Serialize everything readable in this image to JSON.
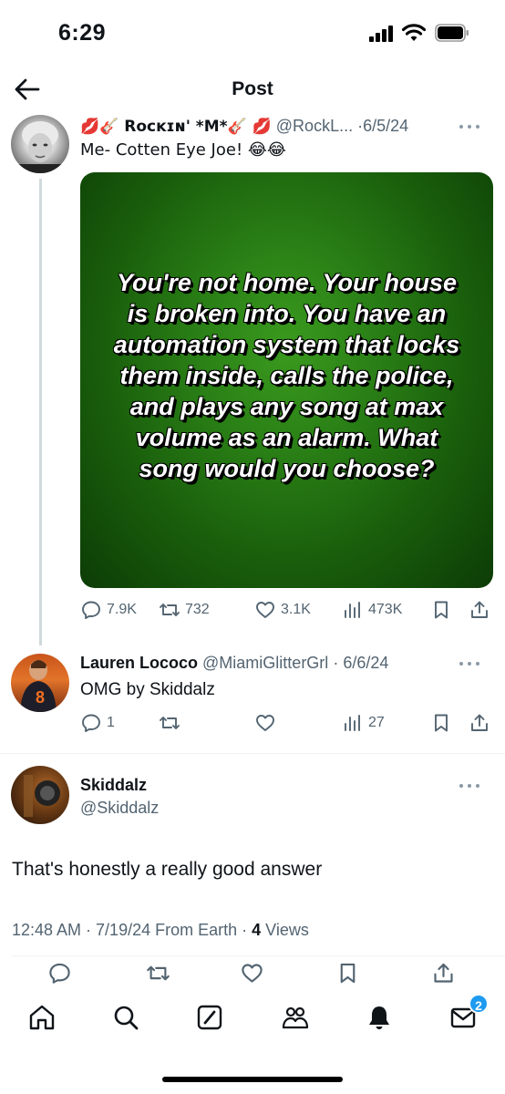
{
  "status_bar": {
    "time": "6:29"
  },
  "header": {
    "title": "Post"
  },
  "tweets": [
    {
      "display_name": "💋🎸 Rᴏᴄᴋɪɴ' *M*🎸 💋",
      "handle": "@RockL...",
      "date": "6/5/24",
      "text": "Me- Cotten Eye Joe! 😂😂",
      "media_text": "You're not home. Your house is broken into. You have an automation system that locks them inside, calls the police, and plays any song at max volume as an alarm. What song would you choose?",
      "stats": {
        "replies": "7.9K",
        "reposts": "732",
        "likes": "3.1K",
        "views": "473K"
      }
    },
    {
      "display_name": "Lauren Lococo",
      "handle": "@MiamiGlitterGrl",
      "date": "6/6/24",
      "text": "OMG by Skiddalz",
      "stats": {
        "replies": "1",
        "views": "27"
      }
    }
  ],
  "main_post": {
    "display_name": "Skiddalz",
    "handle": "@Skiddalz",
    "text": "That's honestly a really good answer",
    "timestamp": "12:48 AM · 7/19/24 From Earth · ",
    "views_count": "4",
    "views_label": " Views"
  },
  "tabbar": {
    "notifications_badge": "2"
  },
  "colors": {
    "accent": "#1d9bf0",
    "secondary_text": "#536471",
    "media_green": "#2a8016"
  }
}
